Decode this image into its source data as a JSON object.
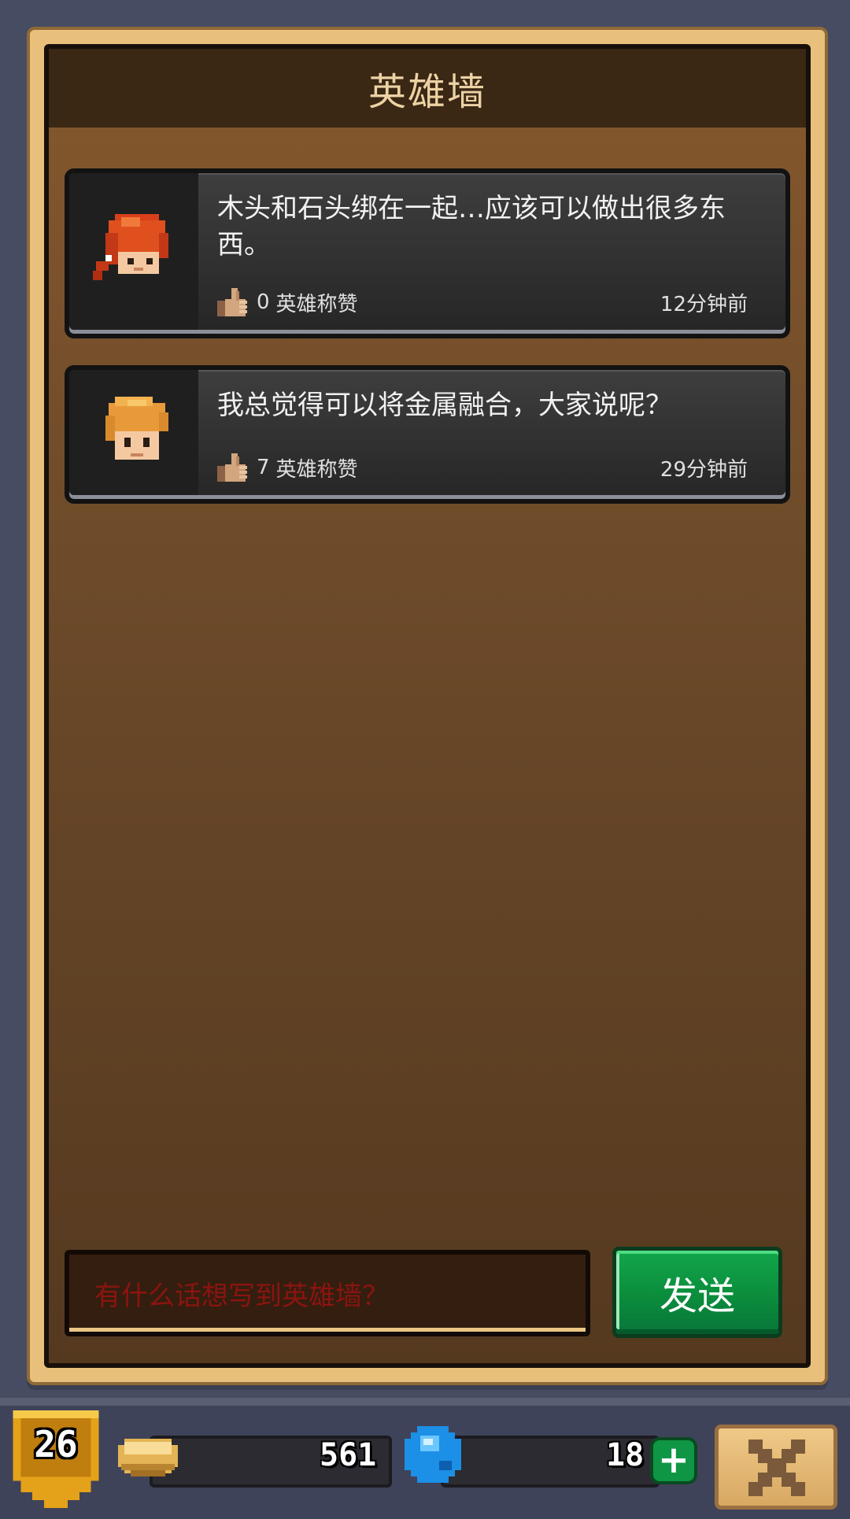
{
  "window": {
    "title": "英雄墙"
  },
  "messages": [
    {
      "avatar": "red-haired-hero-avatar",
      "text": "木头和石头绑在一起…应该可以做出很多东西。",
      "likes": "0",
      "likes_label": "英雄称赞",
      "time": "12分钟前"
    },
    {
      "avatar": "blond-hero-avatar",
      "text": "我总觉得可以将金属融合，大家说呢？",
      "likes": "7",
      "likes_label": "英雄称赞",
      "time": "29分钟前"
    }
  ],
  "composer": {
    "placeholder": "有什么话想写到英雄墙？",
    "send_label": "发送"
  },
  "hud": {
    "level": "26",
    "coins": "561",
    "gems": "18",
    "plus_label": "+"
  },
  "colors": {
    "panel_brown": "#6c4a2a",
    "title_bar": "#3a2714",
    "send_green": "#0b8d3c",
    "placeholder_red": "#8b1410"
  }
}
